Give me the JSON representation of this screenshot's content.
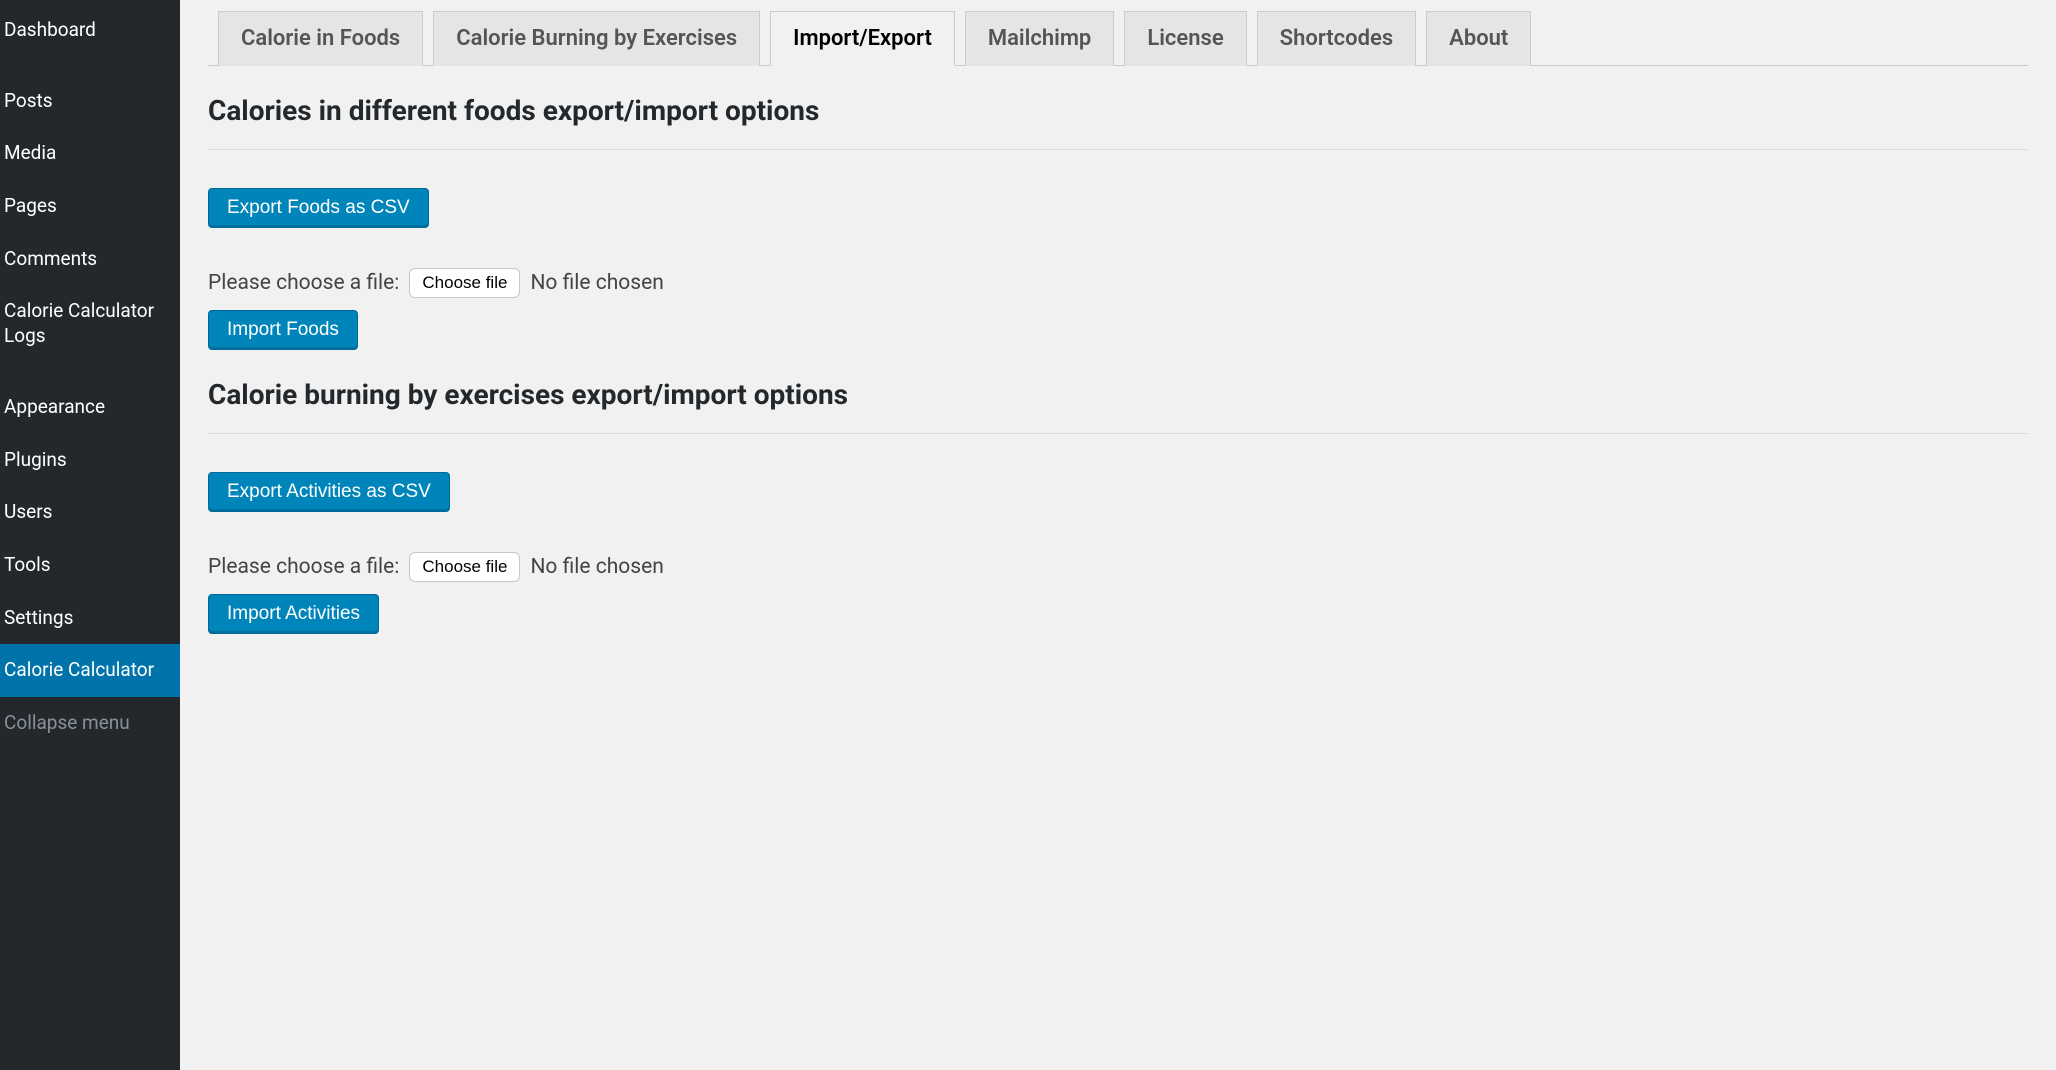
{
  "sidebar": {
    "items": [
      {
        "label": "Dashboard"
      },
      {
        "label": "Posts"
      },
      {
        "label": "Media"
      },
      {
        "label": "Pages"
      },
      {
        "label": "Comments"
      },
      {
        "label": "Calorie Calculator Logs"
      },
      {
        "label": "Appearance"
      },
      {
        "label": "Plugins"
      },
      {
        "label": "Users"
      },
      {
        "label": "Tools"
      },
      {
        "label": "Settings"
      },
      {
        "label": "Calorie Calculator",
        "active": true
      }
    ],
    "collapse_label": "Collapse menu"
  },
  "tabs": [
    {
      "label": "Calorie in Foods"
    },
    {
      "label": "Calorie Burning by Exercises"
    },
    {
      "label": "Import/Export",
      "active": true
    },
    {
      "label": "Mailchimp"
    },
    {
      "label": "License"
    },
    {
      "label": "Shortcodes"
    },
    {
      "label": "About"
    }
  ],
  "foods": {
    "title": "Calories in different foods export/import options",
    "export_label": "Export Foods as CSV",
    "file_prompt": "Please choose a file:",
    "choose_label": "Choose file",
    "no_file": "No file chosen",
    "import_label": "Import Foods"
  },
  "activities": {
    "title": "Calorie burning by exercises export/import options",
    "export_label": "Export Activities as CSV",
    "file_prompt": "Please choose a file:",
    "choose_label": "Choose file",
    "no_file": "No file chosen",
    "import_label": "Import Activities"
  }
}
